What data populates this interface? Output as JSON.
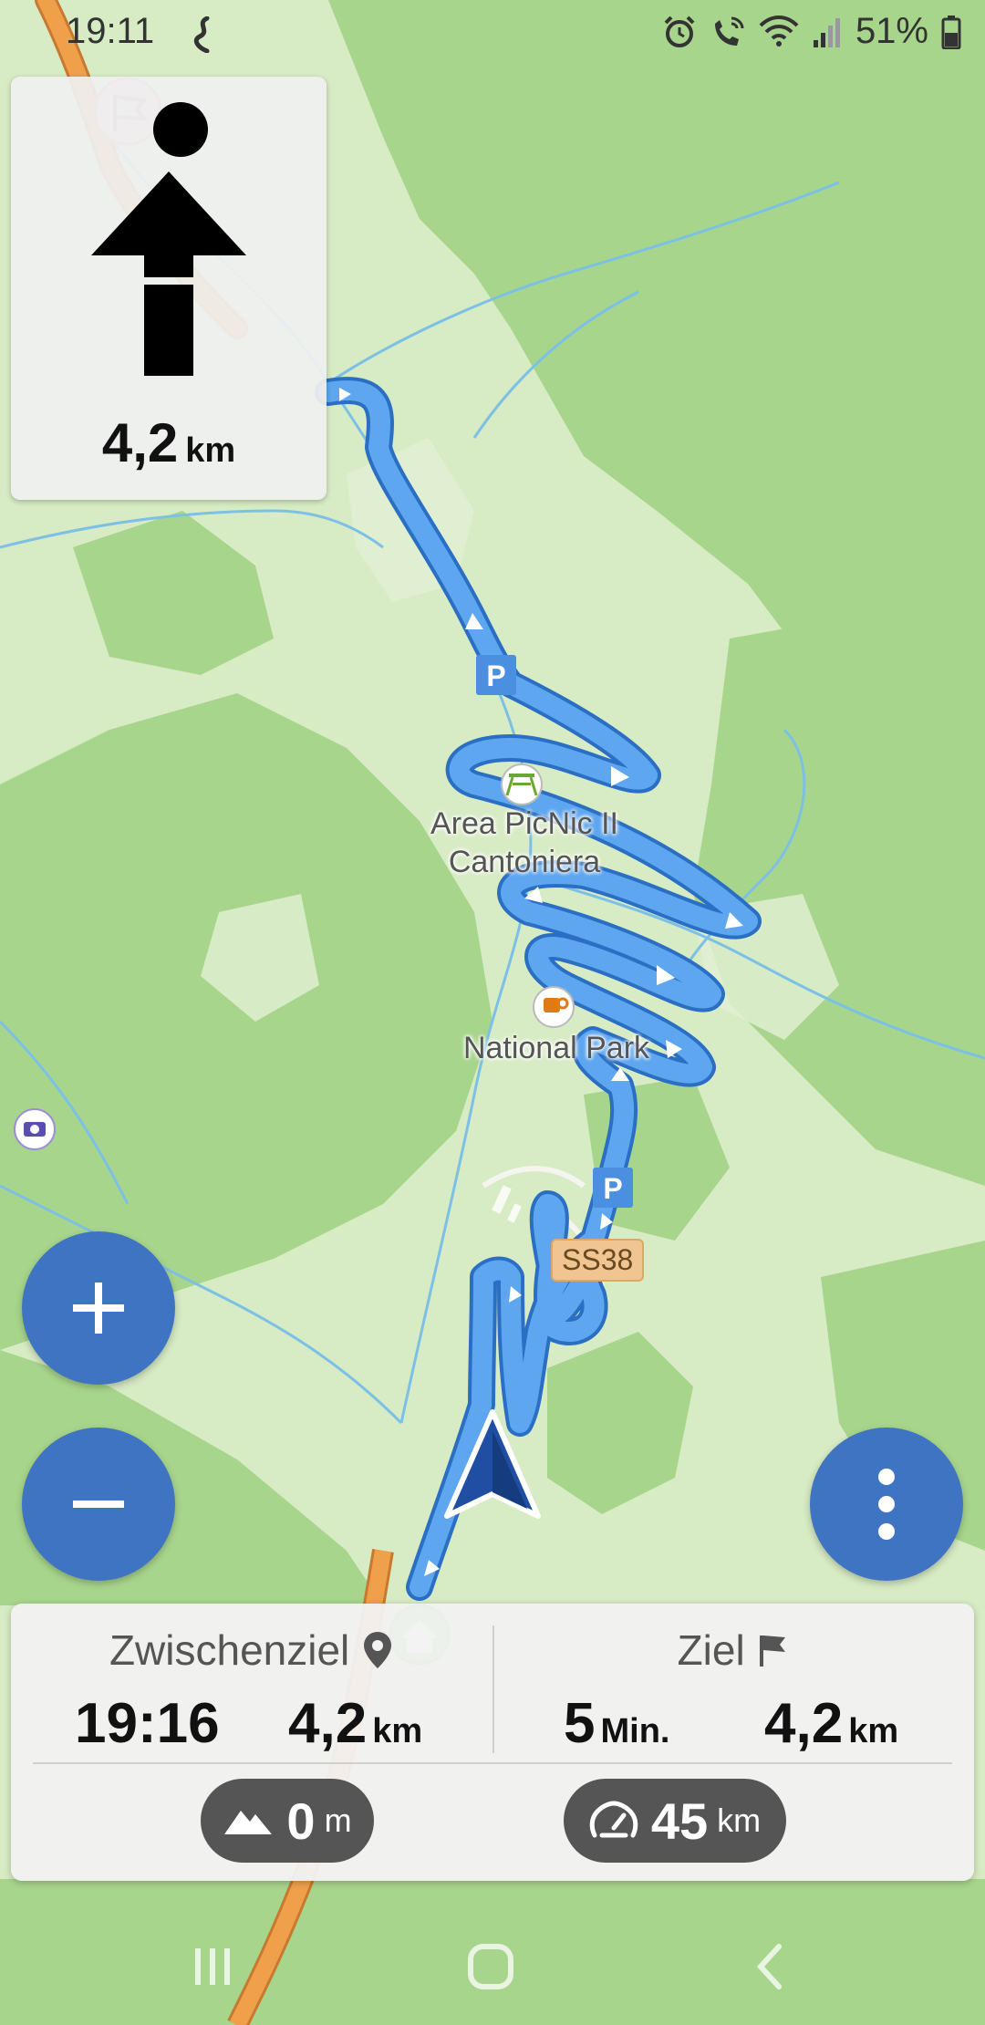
{
  "status_bar": {
    "time": "19:11",
    "battery_percent": "51%",
    "icons": [
      "route-app-icon",
      "alarm-icon",
      "wifi-call-icon",
      "wifi-icon",
      "signal-icon",
      "battery-icon"
    ]
  },
  "turn_instruction": {
    "distance_value": "4,2",
    "distance_unit": "km",
    "icon": "straight-arrow-icon"
  },
  "map": {
    "poi": [
      {
        "label_line1": "Area PicNic II",
        "label_line2": "Cantoniera",
        "icon": "picnic-icon"
      },
      {
        "label": "National Park",
        "icon": "cafe-icon"
      }
    ],
    "road_label": "SS38",
    "parking_label": "P",
    "colors": {
      "route": "#4a97ea",
      "route_outline": "#2b6fc4",
      "forest": "#a6d48a",
      "meadow": "#d7ebc4",
      "water": "#6cb8e0",
      "main_road": "#f0a04b"
    }
  },
  "controls": {
    "zoom_in": "+",
    "zoom_out": "−",
    "menu_icon": "more-vertical-icon"
  },
  "bottom_panel": {
    "waypoint": {
      "title": "Zwischenziel",
      "arrival_time": "19:16",
      "distance_value": "4,2",
      "distance_unit": "km"
    },
    "destination": {
      "title": "Ziel",
      "duration_value": "5",
      "duration_unit": "Min.",
      "distance_value": "4,2",
      "distance_unit": "km"
    },
    "altitude": {
      "value": "0",
      "unit": "m"
    },
    "speed": {
      "value": "45",
      "unit": "km"
    }
  }
}
